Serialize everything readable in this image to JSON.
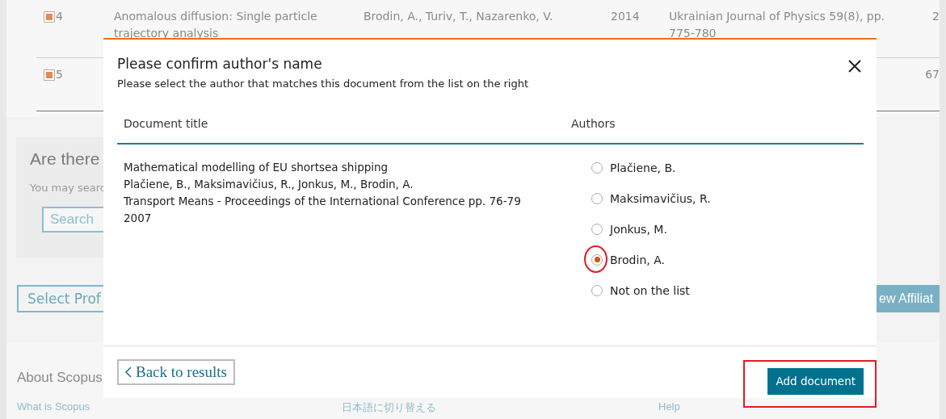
{
  "background": {
    "results": [
      {
        "checked": true,
        "number": "4",
        "title": "Anomalous diffusion: Single particle trajectory analysis",
        "authors": "Brodin, A., Turiv, T., Nazarenko, V.",
        "year": "2014",
        "source": "Ukrainian Journal of Physics 59(8), pp. 775-780",
        "citations": "2"
      },
      {
        "checked": true,
        "number": "5",
        "citations": "67"
      }
    ],
    "question_heading": "Are there",
    "search_hint": "You may searc",
    "search_field": {
      "placeholder": "Search"
    },
    "back_button": "Select Prof",
    "affiliation_button": "ew Affiliat",
    "footer": {
      "heading": "About Scopus",
      "links": [
        "What is Scopus",
        "日本語に切り替える",
        "Help"
      ]
    }
  },
  "dialog": {
    "title": "Please confirm author's name",
    "subtitle": "Please select the author that matches this document from the list on the right",
    "columns": [
      "Document title",
      "Authors"
    ],
    "document": {
      "title": "Mathematical modelling of EU shortsea shipping",
      "authors": "Plačiene, B., Maksimavičius, R., Jonkus, M., Brodin, A.",
      "source": "Transport Means - Proceedings of the International Conference pp. 76-79",
      "year": "2007"
    },
    "authors": [
      {
        "name": "Plačiene, B.",
        "selected": false
      },
      {
        "name": "Maksimavičius, R.",
        "selected": false
      },
      {
        "name": "Jonkus, M.",
        "selected": false
      },
      {
        "name": "Brodin, A.",
        "selected": true
      },
      {
        "name": "Not on the list",
        "selected": false
      }
    ],
    "back_button": "Back to results",
    "add_button": "Add document"
  }
}
